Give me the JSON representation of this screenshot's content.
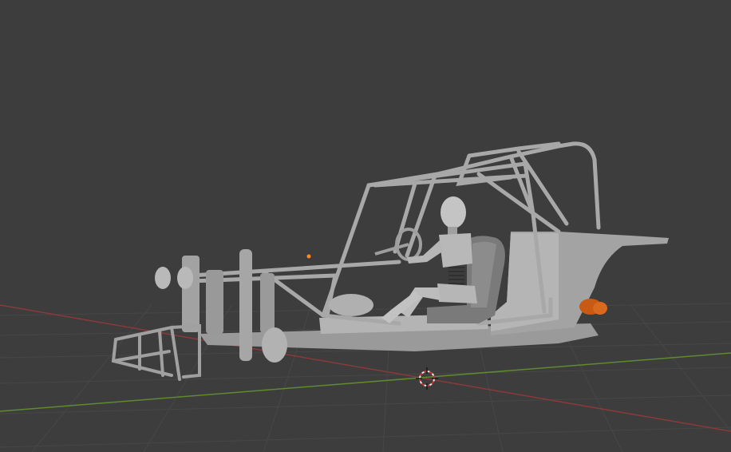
{
  "viewport": {
    "background_color": "#3d3d3d",
    "grid_color": "#474747",
    "x_axis_color": "#8a3a3a",
    "y_axis_color": "#5f8a2e",
    "model_color": "#a8a8a8",
    "model_shadow_color": "#7c7c7c",
    "exhaust_color": "#c85a14",
    "origin_color": "#ff8a1e"
  },
  "scene": {
    "object": "dune-buggy-with-crash-test-dummy",
    "cursor_icon": "3d-cursor-icon",
    "origin_icon": "object-origin-icon"
  }
}
